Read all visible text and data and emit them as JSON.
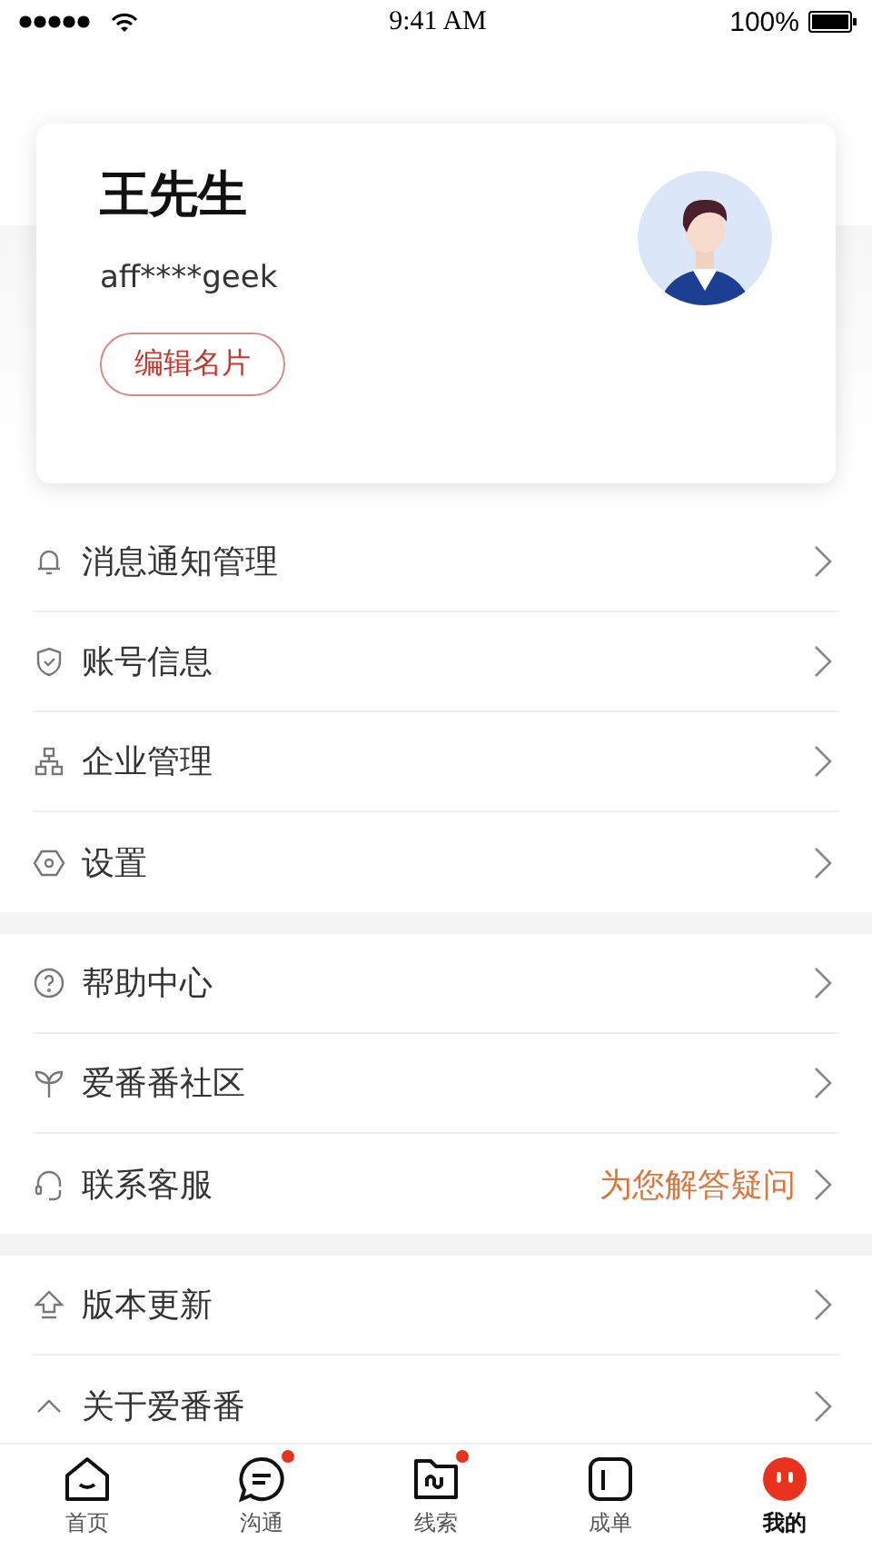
{
  "status_bar": {
    "time": "9:41 AM",
    "battery": "100%"
  },
  "profile": {
    "name": "王先生",
    "account": "aff****geek",
    "edit_button": "编辑名片"
  },
  "menu_groups": [
    {
      "items": [
        {
          "label": "消息通知管理"
        },
        {
          "label": "账号信息"
        },
        {
          "label": "企业管理"
        },
        {
          "label": "设置"
        }
      ]
    },
    {
      "items": [
        {
          "label": "帮助中心"
        },
        {
          "label": "爱番番社区"
        },
        {
          "label": "联系客服",
          "hint": "为您解答疑问"
        }
      ]
    },
    {
      "items": [
        {
          "label": "版本更新"
        },
        {
          "label": "关于爱番番"
        }
      ]
    }
  ],
  "tab_bar": [
    {
      "label": "首页",
      "selected": false,
      "badge": false
    },
    {
      "label": "沟通",
      "selected": false,
      "badge": true
    },
    {
      "label": "线索",
      "selected": false,
      "badge": true
    },
    {
      "label": "成单",
      "selected": false,
      "badge": false
    },
    {
      "label": "我的",
      "selected": true,
      "badge": false
    }
  ]
}
